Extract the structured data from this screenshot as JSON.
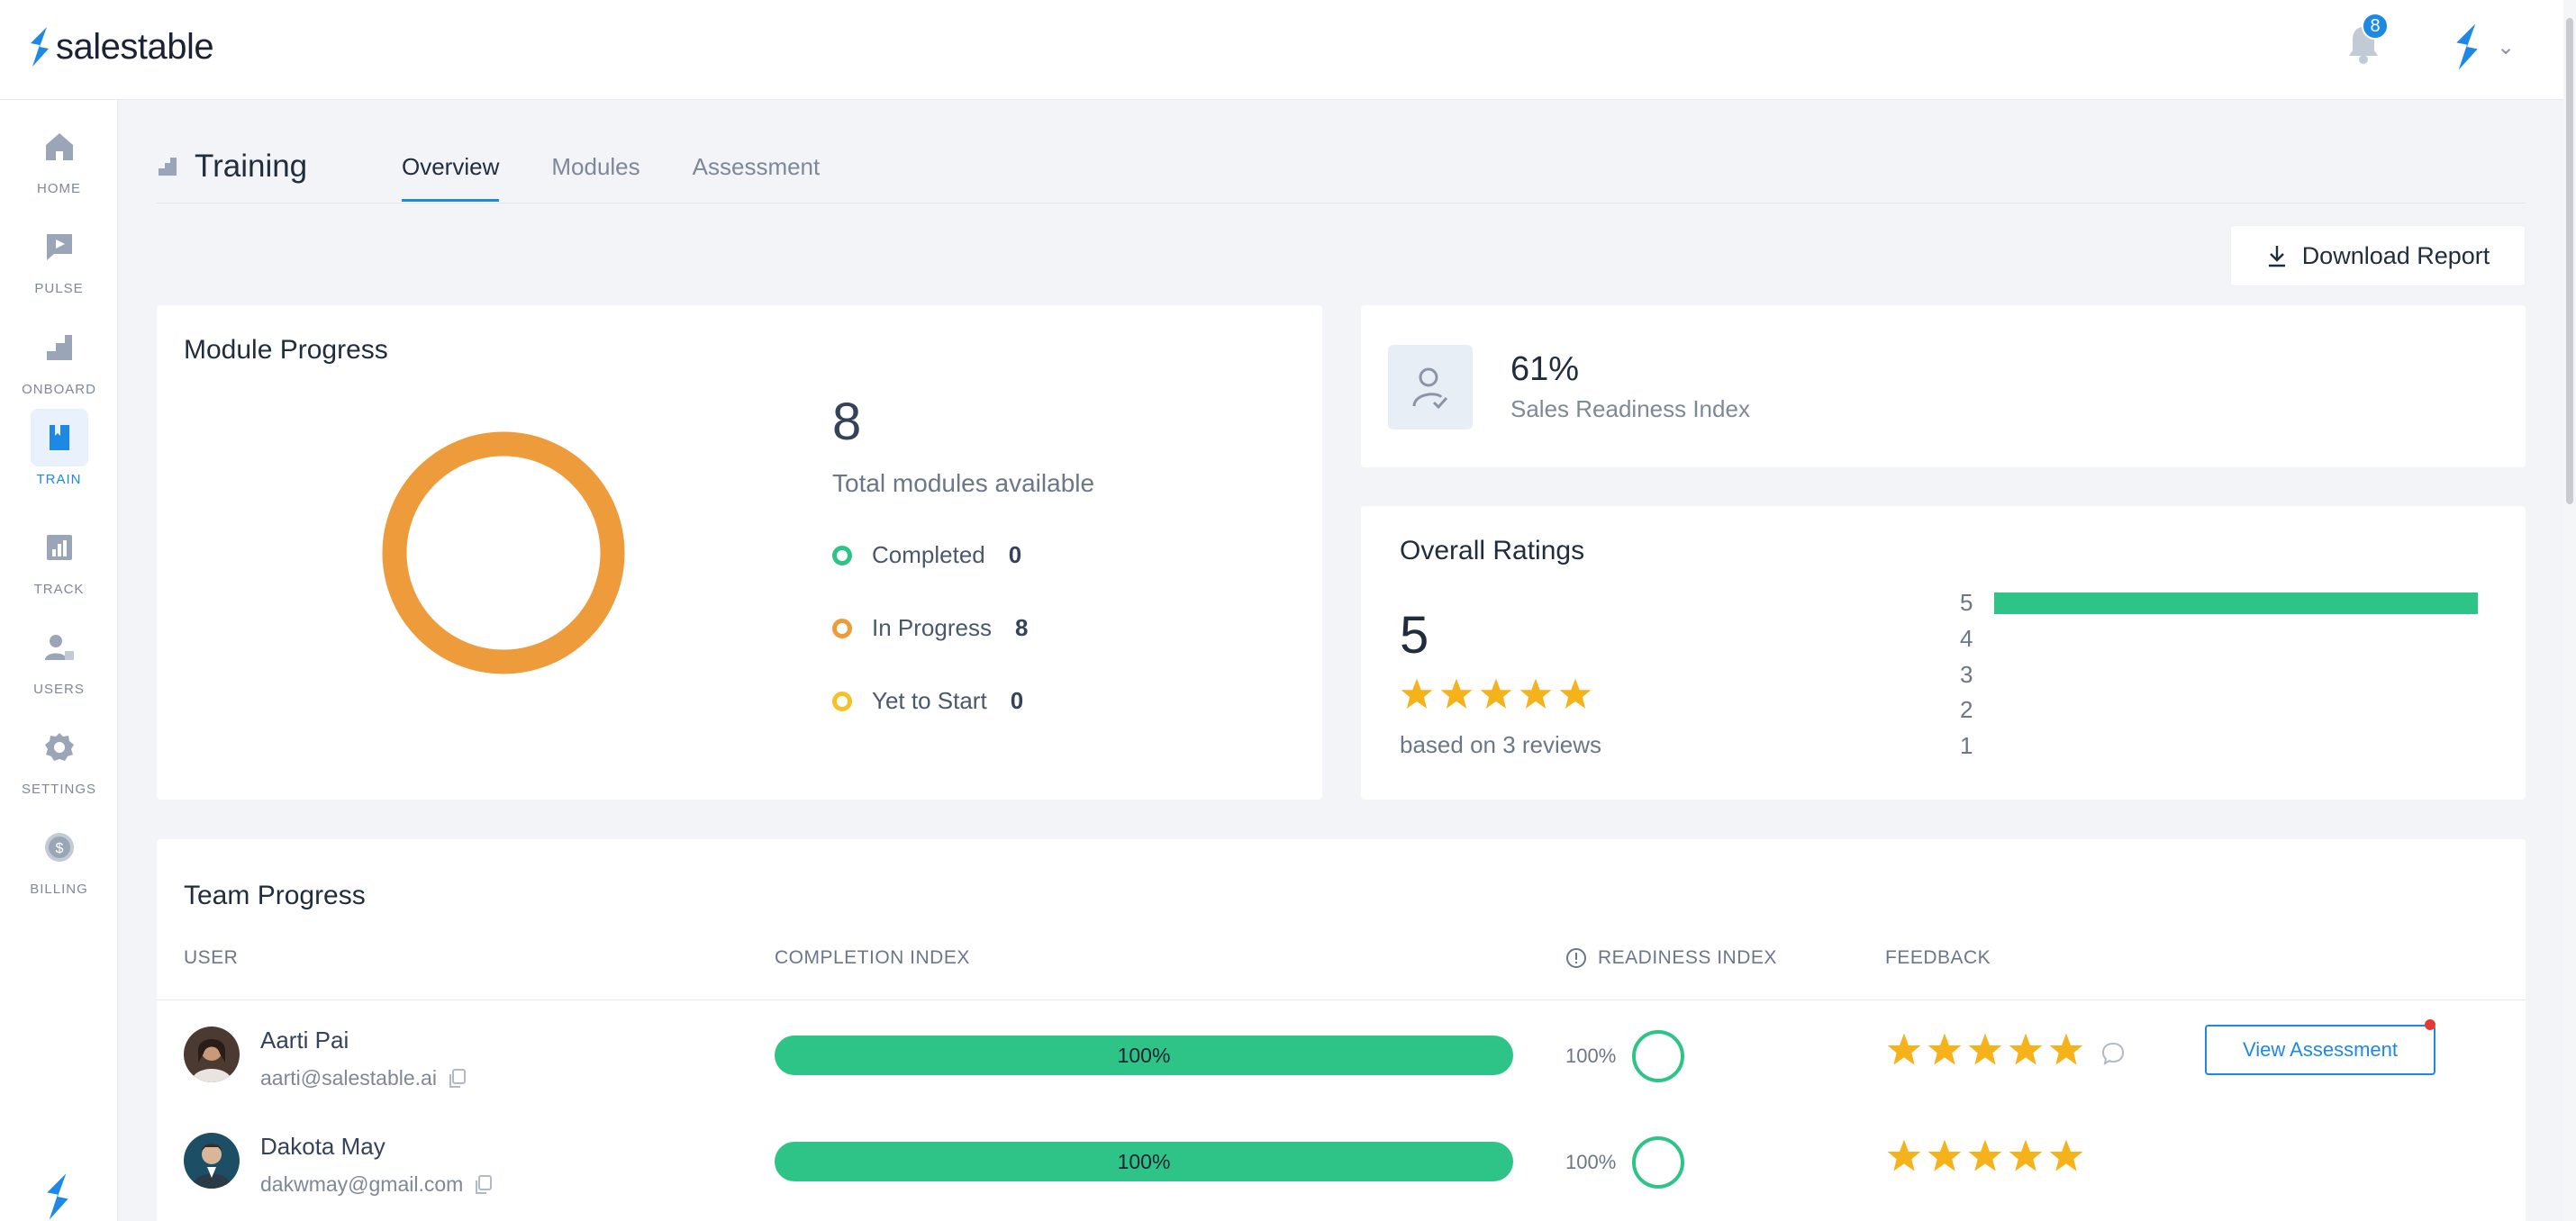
{
  "app": {
    "brand": "salestable"
  },
  "topbar": {
    "notification_count": "8"
  },
  "sidebar": {
    "items": [
      {
        "label": "HOME",
        "icon": "home-icon"
      },
      {
        "label": "PULSE",
        "icon": "chat-icon"
      },
      {
        "label": "ONBOARD",
        "icon": "steps-icon"
      },
      {
        "label": "TRAIN",
        "icon": "book-icon",
        "active": true
      },
      {
        "label": "TRACK",
        "icon": "chart-icon"
      },
      {
        "label": "USERS",
        "icon": "users-icon"
      },
      {
        "label": "SETTINGS",
        "icon": "gear-icon"
      },
      {
        "label": "BILLING",
        "icon": "dollar-icon"
      }
    ]
  },
  "page": {
    "title": "Training",
    "tabs": [
      {
        "label": "Overview",
        "active": true
      },
      {
        "label": "Modules"
      },
      {
        "label": "Assessment"
      }
    ],
    "download_label": "Download Report"
  },
  "module_progress": {
    "title": "Module Progress",
    "total": "8",
    "total_label": "Total modules available",
    "legend": [
      {
        "label": "Completed",
        "value": "0",
        "color": "#2ec487"
      },
      {
        "label": "In Progress",
        "value": "8",
        "color": "#ee9c3b"
      },
      {
        "label": "Yet to Start",
        "value": "0",
        "color": "#f6c02b"
      }
    ],
    "donut_color": "#ee9c3b"
  },
  "readiness": {
    "value": "61%",
    "label": "Sales Readiness Index"
  },
  "ratings": {
    "title": "Overall Ratings",
    "score": "5",
    "stars": 5,
    "reviews_label": "based on 3 reviews",
    "distribution": [
      {
        "label": "5",
        "fraction": 1.0
      },
      {
        "label": "4",
        "fraction": 0
      },
      {
        "label": "3",
        "fraction": 0
      },
      {
        "label": "2",
        "fraction": 0
      },
      {
        "label": "1",
        "fraction": 0
      }
    ]
  },
  "team": {
    "title": "Team Progress",
    "columns": {
      "user": "USER",
      "completion": "COMPLETION INDEX",
      "readiness": "READINESS INDEX",
      "feedback": "FEEDBACK"
    },
    "rows": [
      {
        "name": "Aarti Pai",
        "email": "aarti@salestable.ai",
        "completion": "100%",
        "readiness": "100%",
        "stars": 5,
        "action": "View Assessment"
      },
      {
        "name": "Dakota May",
        "email": "dakwmay@gmail.com",
        "completion": "100%",
        "readiness": "100%",
        "stars": 5
      }
    ]
  }
}
